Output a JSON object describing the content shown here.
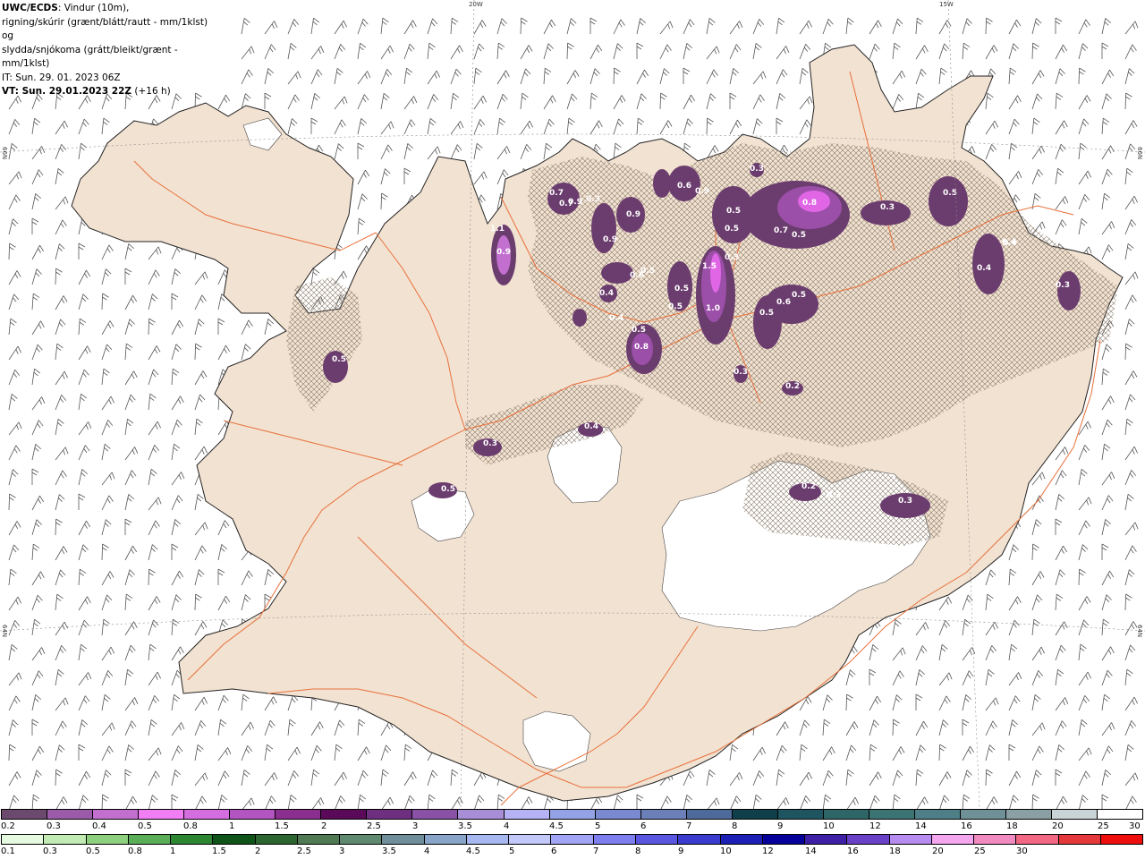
{
  "title": {
    "source": "UWC/ECDS",
    "line1_rest": ": Vindur (10m),",
    "line2": "rigning/skúrir (grænt/blátt/rautt - mm/1klst) og",
    "line3": "slydda/snjókoma (grátt/bleikt/grænt - mm/1klst)",
    "line4": "IT: Sun. 29. 01. 2023 06Z",
    "line5_bold": "VT: Sun. 29.01.2023 22Z",
    "line5_rest": " (+16 h)"
  },
  "grid_labels": {
    "lon_20w": "20W",
    "lon_15w": "15W",
    "lat_66n_left": "66N",
    "lat_66n_right": "66N",
    "lat_64n_left": "64N",
    "lat_64n_right": "64N"
  },
  "precip_labels": [
    "0.7",
    "0.9",
    "0.3",
    "1.1",
    "0.9",
    "0.9",
    "0.4",
    "0.6",
    "0.9",
    "0.5",
    "0.5",
    "0.3",
    "0.3",
    "0.8",
    "0.7",
    "0.5",
    "0.3",
    "0.5",
    "0.4",
    "0.4",
    "0.3",
    "0.5",
    "1.5",
    "1.0",
    "0.5",
    "0.5",
    "0.5",
    "0.6",
    "0.5",
    "0.6",
    "0.8",
    "0.3",
    "0.2",
    "0.5",
    "0.3",
    "0.4",
    "0.2",
    "0.4",
    "0.3",
    "0.3",
    "0.5",
    "0.5",
    "0.9",
    "0.4",
    "0.7"
  ],
  "colors": {
    "land": "#f2e2d2",
    "sea": "#ffffff",
    "roads": "#e8703a",
    "coast": "#222222",
    "glacier": "#ffffff",
    "wind_barb": "#444444",
    "precip_dark": "#6b3d6e",
    "precip_mid": "#9c4fa8",
    "precip_light": "#e066e6"
  },
  "legend": {
    "snow_colors": [
      "#6b4a6e",
      "#9c5ba8",
      "#c26fcf",
      "#f17ef5",
      "#d46ddf",
      "#b454c2",
      "#8a2e90",
      "#5b0a5a",
      "#6e2f80",
      "#8a52a6",
      "#a88ed6",
      "#b5b3f5",
      "#95a3e6",
      "#7a8ad0",
      "#6b80b8",
      "#4e6a9a",
      "#0e3f4a",
      "#1f5560",
      "#2e6567",
      "#3b7472",
      "#4e7f86",
      "#6e9096",
      "#8aa0a4",
      "#c9d4d6",
      "#ffffff"
    ],
    "snow_labels": [
      "0.2",
      "0.3",
      "0.4",
      "0.5",
      "0.8",
      "1",
      "1.5",
      "2",
      "2.5",
      "3",
      "3.5",
      "4",
      "4.5",
      "5",
      "6",
      "7",
      "8",
      "9",
      "10",
      "12",
      "14",
      "16",
      "18",
      "20",
      "25",
      "30"
    ],
    "rain_colors": [
      "#e5fadf",
      "#c1ebb3",
      "#8fd07f",
      "#59ae57",
      "#2c8632",
      "#0e5418",
      "#2c6530",
      "#4f7a54",
      "#5f8a6f",
      "#708e99",
      "#88a4c8",
      "#a6b8ef",
      "#c3c8fb",
      "#a2a4f5",
      "#7d7fef",
      "#5a56e0",
      "#3a3ccd",
      "#1d20b4",
      "#06009a",
      "#3d20a5",
      "#6a40c7",
      "#b68cf0",
      "#f4a7ef",
      "#f18ac0",
      "#f26784",
      "#e5383a",
      "#ee0e0e"
    ],
    "rain_labels": [
      "0.1",
      "0.3",
      "0.5",
      "0.8",
      "1",
      "1.5",
      "2",
      "2.5",
      "3",
      "3.5",
      "4",
      "4.5",
      "5",
      "6",
      "7",
      "8",
      "9",
      "10",
      "12",
      "14",
      "16",
      "18",
      "20",
      "25",
      "30"
    ]
  }
}
